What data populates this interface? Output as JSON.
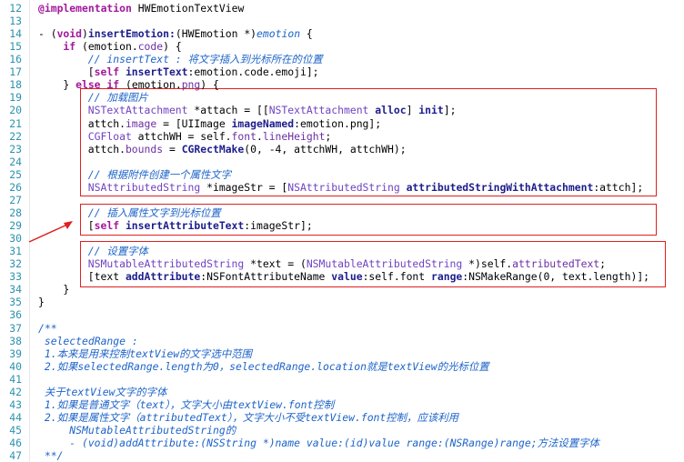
{
  "editor": {
    "lines": [
      {
        "n": "12",
        "indent": 0,
        "tokens": [
          {
            "t": "@implementation",
            "c": "kw"
          },
          {
            "t": " HWEmotionTextView",
            "c": "nm"
          }
        ]
      },
      {
        "n": "13",
        "indent": 0,
        "tokens": []
      },
      {
        "n": "14",
        "indent": 0,
        "tokens": [
          {
            "t": "- (",
            "c": "nm"
          },
          {
            "t": "void",
            "c": "kw"
          },
          {
            "t": ")",
            "c": "nm"
          },
          {
            "t": "insertEmotion:",
            "c": "fn"
          },
          {
            "t": "(HWEmotion *)",
            "c": "nm"
          },
          {
            "t": "emotion",
            "c": "cm"
          },
          {
            "t": " {",
            "c": "nm"
          }
        ]
      },
      {
        "n": "15",
        "indent": 4,
        "tokens": [
          {
            "t": "if",
            "c": "kw"
          },
          {
            "t": " (emotion.",
            "c": "nm"
          },
          {
            "t": "code",
            "c": "pr"
          },
          {
            "t": ") {",
            "c": "nm"
          }
        ]
      },
      {
        "n": "16",
        "indent": 8,
        "tokens": [
          {
            "t": "// insertText : 将文字插入到光标所在的位置",
            "c": "cm"
          }
        ]
      },
      {
        "n": "17",
        "indent": 8,
        "tokens": [
          {
            "t": "[",
            "c": "nm"
          },
          {
            "t": "self",
            "c": "kw"
          },
          {
            "t": " ",
            "c": "nm"
          },
          {
            "t": "insertText",
            "c": "fn"
          },
          {
            "t": ":emotion.code.emoji];",
            "c": "nm"
          }
        ]
      },
      {
        "n": "18",
        "indent": 4,
        "tokens": [
          {
            "t": "} ",
            "c": "nm"
          },
          {
            "t": "else if",
            "c": "kw"
          },
          {
            "t": " (emotion.",
            "c": "nm"
          },
          {
            "t": "png",
            "c": "pr"
          },
          {
            "t": ") {",
            "c": "nm"
          }
        ]
      },
      {
        "n": "19",
        "indent": 8,
        "tokens": [
          {
            "t": "// 加载图片",
            "c": "cm"
          }
        ]
      },
      {
        "n": "20",
        "indent": 8,
        "tokens": [
          {
            "t": "NSTextAttachment",
            "c": "ty"
          },
          {
            "t": " *attach = [[",
            "c": "nm"
          },
          {
            "t": "NSTextAttachment",
            "c": "ty"
          },
          {
            "t": " ",
            "c": "nm"
          },
          {
            "t": "alloc",
            "c": "fn"
          },
          {
            "t": "] ",
            "c": "nm"
          },
          {
            "t": "init",
            "c": "fn"
          },
          {
            "t": "];",
            "c": "nm"
          }
        ]
      },
      {
        "n": "21",
        "indent": 8,
        "tokens": [
          {
            "t": "attch.",
            "c": "nm"
          },
          {
            "t": "image",
            "c": "pr"
          },
          {
            "t": " = [UIImage ",
            "c": "nm"
          },
          {
            "t": "imageNamed",
            "c": "fn"
          },
          {
            "t": ":emotion.png];",
            "c": "nm"
          }
        ]
      },
      {
        "n": "22",
        "indent": 8,
        "tokens": [
          {
            "t": "CGFloat",
            "c": "ty"
          },
          {
            "t": " attchWH = self.",
            "c": "nm"
          },
          {
            "t": "font",
            "c": "pr"
          },
          {
            "t": ".",
            "c": "nm"
          },
          {
            "t": "lineHeight",
            "c": "pr"
          },
          {
            "t": ";",
            "c": "nm"
          }
        ]
      },
      {
        "n": "23",
        "indent": 8,
        "tokens": [
          {
            "t": "attch.",
            "c": "nm"
          },
          {
            "t": "bounds",
            "c": "pr"
          },
          {
            "t": " = ",
            "c": "nm"
          },
          {
            "t": "CGRectMake",
            "c": "fn"
          },
          {
            "t": "(0, -4, attchWH, attchWH);",
            "c": "nm"
          }
        ]
      },
      {
        "n": "24",
        "indent": 0,
        "tokens": []
      },
      {
        "n": "25",
        "indent": 8,
        "tokens": [
          {
            "t": "// 根据附件创建一个属性文字",
            "c": "cm"
          }
        ]
      },
      {
        "n": "26",
        "indent": 8,
        "tokens": [
          {
            "t": "NSAttributedString",
            "c": "ty"
          },
          {
            "t": " *imageStr = [",
            "c": "nm"
          },
          {
            "t": "NSAttributedString",
            "c": "ty"
          },
          {
            "t": " ",
            "c": "nm"
          },
          {
            "t": "attributedStringWithAttachment",
            "c": "fn"
          },
          {
            "t": ":attch];",
            "c": "nm"
          }
        ]
      },
      {
        "n": "27",
        "indent": 0,
        "tokens": []
      },
      {
        "n": "28",
        "indent": 8,
        "tokens": [
          {
            "t": "// 插入属性文字到光标位置",
            "c": "cm"
          }
        ]
      },
      {
        "n": "29",
        "indent": 8,
        "tokens": [
          {
            "t": "[",
            "c": "nm"
          },
          {
            "t": "self",
            "c": "kw"
          },
          {
            "t": " ",
            "c": "nm"
          },
          {
            "t": "insertAttributeText",
            "c": "fn"
          },
          {
            "t": ":imageStr];",
            "c": "nm"
          }
        ]
      },
      {
        "n": "30",
        "indent": 0,
        "tokens": []
      },
      {
        "n": "31",
        "indent": 8,
        "tokens": [
          {
            "t": "// 设置字体",
            "c": "cm"
          }
        ]
      },
      {
        "n": "32",
        "indent": 8,
        "tokens": [
          {
            "t": "NSMutableAttributedString",
            "c": "ty"
          },
          {
            "t": " *text = (",
            "c": "nm"
          },
          {
            "t": "NSMutableAttributedString",
            "c": "ty"
          },
          {
            "t": " *)self.",
            "c": "nm"
          },
          {
            "t": "attributedText",
            "c": "pr"
          },
          {
            "t": ";",
            "c": "nm"
          }
        ]
      },
      {
        "n": "33",
        "indent": 8,
        "tokens": [
          {
            "t": "[text ",
            "c": "nm"
          },
          {
            "t": "addAttribute",
            "c": "fn"
          },
          {
            "t": ":NSFontAttributeName ",
            "c": "nm"
          },
          {
            "t": "value",
            "c": "fn"
          },
          {
            "t": ":self.font ",
            "c": "nm"
          },
          {
            "t": "range",
            "c": "fn"
          },
          {
            "t": ":NSMakeRange(0, text.length)];",
            "c": "nm"
          }
        ]
      },
      {
        "n": "34",
        "indent": 4,
        "tokens": [
          {
            "t": "}",
            "c": "nm"
          }
        ]
      },
      {
        "n": "35",
        "indent": 0,
        "tokens": [
          {
            "t": "}",
            "c": "nm"
          }
        ]
      },
      {
        "n": "36",
        "indent": 0,
        "tokens": []
      },
      {
        "n": "37",
        "indent": 0,
        "tokens": [
          {
            "t": "/**",
            "c": "cm"
          }
        ]
      },
      {
        "n": "38",
        "indent": 1,
        "tokens": [
          {
            "t": "selectedRange :",
            "c": "cm"
          }
        ]
      },
      {
        "n": "39",
        "indent": 1,
        "tokens": [
          {
            "t": "1.本来是用来控制textView的文字选中范围",
            "c": "cm"
          }
        ]
      },
      {
        "n": "40",
        "indent": 1,
        "tokens": [
          {
            "t": "2.如果selectedRange.length为0，selectedRange.location就是textView的光标位置",
            "c": "cm"
          }
        ]
      },
      {
        "n": "41",
        "indent": 0,
        "tokens": []
      },
      {
        "n": "42",
        "indent": 1,
        "tokens": [
          {
            "t": "关于textView文字的字体",
            "c": "cm"
          }
        ]
      },
      {
        "n": "43",
        "indent": 1,
        "tokens": [
          {
            "t": "1.如果是普通文字（text），文字大小由textView.font控制",
            "c": "cm"
          }
        ]
      },
      {
        "n": "44",
        "indent": 1,
        "tokens": [
          {
            "t": "2.如果是属性文字（attributedText），文字大小不受textView.font控制，应该利用",
            "c": "cm"
          }
        ]
      },
      {
        "n": "45",
        "indent": 5,
        "tokens": [
          {
            "t": "NSMutableAttributedString的",
            "c": "cm"
          }
        ]
      },
      {
        "n": "46",
        "indent": 5,
        "tokens": [
          {
            "t": "- (void)addAttribute:(NSString *)name value:(id)value range:(NSRange)range;方法设置字体",
            "c": "cm"
          }
        ]
      },
      {
        "n": "47",
        "indent": 1,
        "tokens": [
          {
            "t": "**/",
            "c": "cm"
          }
        ]
      }
    ]
  }
}
